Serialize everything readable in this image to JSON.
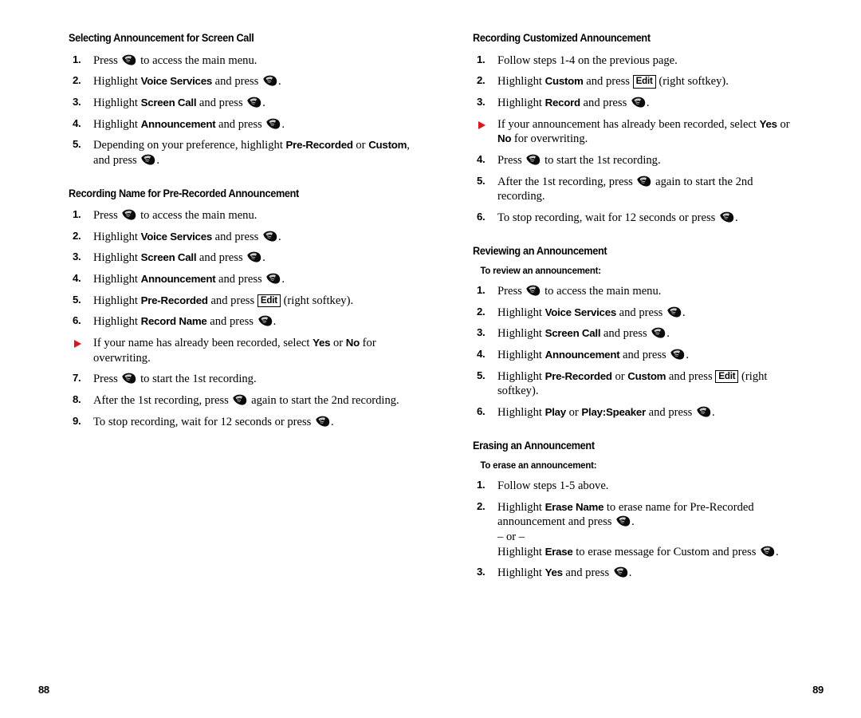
{
  "document": {
    "type": "phone-user-manual-page-spread",
    "icon_names": {
      "ok_key": "ok-key-icon",
      "note_bullet": "red-triangle-bullet-icon"
    },
    "colors": {
      "note_bullet_red": "#e1121a",
      "text": "#000000",
      "background": "#ffffff"
    }
  },
  "left_page": {
    "folio": "88",
    "sections": [
      {
        "heading": "Selecting Announcement for Screen Call",
        "steps": [
          {
            "num": "1.",
            "parts": [
              {
                "t": "text",
                "v": "Press "
              },
              {
                "t": "okkey"
              },
              {
                "t": "text",
                "v": " to access the main menu."
              }
            ]
          },
          {
            "num": "2.",
            "parts": [
              {
                "t": "text",
                "v": "Highlight "
              },
              {
                "t": "bold",
                "v": "Voice Services"
              },
              {
                "t": "text",
                "v": " and press "
              },
              {
                "t": "okkey"
              },
              {
                "t": "text",
                "v": "."
              }
            ]
          },
          {
            "num": "3.",
            "parts": [
              {
                "t": "text",
                "v": "Highlight "
              },
              {
                "t": "bold",
                "v": "Screen Call"
              },
              {
                "t": "text",
                "v": " and press "
              },
              {
                "t": "okkey"
              },
              {
                "t": "text",
                "v": "."
              }
            ]
          },
          {
            "num": "4.",
            "parts": [
              {
                "t": "text",
                "v": "Highlight "
              },
              {
                "t": "bold",
                "v": "Announcement"
              },
              {
                "t": "text",
                "v": " and press "
              },
              {
                "t": "okkey"
              },
              {
                "t": "text",
                "v": "."
              }
            ]
          },
          {
            "num": "5.",
            "parts": [
              {
                "t": "text",
                "v": "Depending on your preference, highlight "
              },
              {
                "t": "bold",
                "v": "Pre-Recorded"
              },
              {
                "t": "text",
                "v": " or "
              },
              {
                "t": "bold",
                "v": "Custom"
              },
              {
                "t": "text",
                "v": ", and press "
              },
              {
                "t": "okkey"
              },
              {
                "t": "text",
                "v": "."
              }
            ]
          }
        ]
      },
      {
        "heading": "Recording Name for Pre-Recorded Announcement",
        "steps": [
          {
            "num": "1.",
            "parts": [
              {
                "t": "text",
                "v": "Press "
              },
              {
                "t": "okkey"
              },
              {
                "t": "text",
                "v": " to access the main menu."
              }
            ]
          },
          {
            "num": "2.",
            "parts": [
              {
                "t": "text",
                "v": "Highlight "
              },
              {
                "t": "bold",
                "v": "Voice Services"
              },
              {
                "t": "text",
                "v": " and press "
              },
              {
                "t": "okkey"
              },
              {
                "t": "text",
                "v": "."
              }
            ]
          },
          {
            "num": "3.",
            "parts": [
              {
                "t": "text",
                "v": "Highlight "
              },
              {
                "t": "bold",
                "v": "Screen Call"
              },
              {
                "t": "text",
                "v": " and press "
              },
              {
                "t": "okkey"
              },
              {
                "t": "text",
                "v": "."
              }
            ]
          },
          {
            "num": "4.",
            "parts": [
              {
                "t": "text",
                "v": "Highlight "
              },
              {
                "t": "bold",
                "v": "Announcement"
              },
              {
                "t": "text",
                "v": " and press "
              },
              {
                "t": "okkey"
              },
              {
                "t": "text",
                "v": "."
              }
            ]
          },
          {
            "num": "5.",
            "parts": [
              {
                "t": "text",
                "v": "Highlight "
              },
              {
                "t": "bold",
                "v": "Pre-Recorded"
              },
              {
                "t": "text",
                "v": " and press "
              },
              {
                "t": "softkey",
                "v": "Edit"
              },
              {
                "t": "text",
                "v": " (right softkey)."
              }
            ]
          },
          {
            "num": "6.",
            "parts": [
              {
                "t": "text",
                "v": "Highlight "
              },
              {
                "t": "bold",
                "v": "Record Name"
              },
              {
                "t": "text",
                "v": " and press "
              },
              {
                "t": "okkey"
              },
              {
                "t": "text",
                "v": "."
              }
            ]
          },
          {
            "num": "note",
            "parts": [
              {
                "t": "text",
                "v": "If your name has already been recorded, select "
              },
              {
                "t": "bold",
                "v": "Yes"
              },
              {
                "t": "text",
                "v": " or "
              },
              {
                "t": "bold",
                "v": "No"
              },
              {
                "t": "text",
                "v": " for overwriting."
              }
            ]
          },
          {
            "num": "7.",
            "parts": [
              {
                "t": "text",
                "v": "Press "
              },
              {
                "t": "okkey"
              },
              {
                "t": "text",
                "v": " to start the 1st recording."
              }
            ]
          },
          {
            "num": "8.",
            "parts": [
              {
                "t": "text",
                "v": "After the 1st recording, press "
              },
              {
                "t": "okkey"
              },
              {
                "t": "text",
                "v": " again to start the 2nd recording."
              }
            ]
          },
          {
            "num": "9.",
            "parts": [
              {
                "t": "text",
                "v": "To stop recording, wait for 12 seconds or press "
              },
              {
                "t": "okkey"
              },
              {
                "t": "text",
                "v": "."
              }
            ]
          }
        ]
      }
    ]
  },
  "right_page": {
    "folio": "89",
    "sections": [
      {
        "heading": "Recording Customized Announcement",
        "steps": [
          {
            "num": "1.",
            "parts": [
              {
                "t": "text",
                "v": "Follow steps 1-4 on the previous page."
              }
            ]
          },
          {
            "num": "2.",
            "parts": [
              {
                "t": "text",
                "v": "Highlight "
              },
              {
                "t": "bold",
                "v": "Custom"
              },
              {
                "t": "text",
                "v": " and press "
              },
              {
                "t": "softkey",
                "v": "Edit"
              },
              {
                "t": "text",
                "v": " (right softkey)."
              }
            ]
          },
          {
            "num": "3.",
            "parts": [
              {
                "t": "text",
                "v": "Highlight "
              },
              {
                "t": "bold",
                "v": "Record"
              },
              {
                "t": "text",
                "v": " and press "
              },
              {
                "t": "okkey"
              },
              {
                "t": "text",
                "v": "."
              }
            ]
          },
          {
            "num": "note",
            "parts": [
              {
                "t": "text",
                "v": "If your announcement has already been recorded, select "
              },
              {
                "t": "bold",
                "v": "Yes"
              },
              {
                "t": "text",
                "v": " or "
              },
              {
                "t": "bold",
                "v": "No"
              },
              {
                "t": "text",
                "v": " for overwriting."
              }
            ]
          },
          {
            "num": "4.",
            "parts": [
              {
                "t": "text",
                "v": "Press "
              },
              {
                "t": "okkey"
              },
              {
                "t": "text",
                "v": " to start the 1st recording."
              }
            ]
          },
          {
            "num": "5.",
            "parts": [
              {
                "t": "text",
                "v": "After the 1st recording, press "
              },
              {
                "t": "okkey"
              },
              {
                "t": "text",
                "v": " again to start the 2nd recording."
              }
            ]
          },
          {
            "num": "6.",
            "parts": [
              {
                "t": "text",
                "v": "To stop recording, wait for 12 seconds or press "
              },
              {
                "t": "okkey"
              },
              {
                "t": "text",
                "v": "."
              }
            ]
          }
        ]
      },
      {
        "heading": "Reviewing an Announcement",
        "subheading": "To review an announcement:",
        "steps": [
          {
            "num": "1.",
            "parts": [
              {
                "t": "text",
                "v": "Press "
              },
              {
                "t": "okkey"
              },
              {
                "t": "text",
                "v": " to access the main menu."
              }
            ]
          },
          {
            "num": "2.",
            "parts": [
              {
                "t": "text",
                "v": "Highlight "
              },
              {
                "t": "bold",
                "v": "Voice Services"
              },
              {
                "t": "text",
                "v": " and press "
              },
              {
                "t": "okkey"
              },
              {
                "t": "text",
                "v": "."
              }
            ]
          },
          {
            "num": "3.",
            "parts": [
              {
                "t": "text",
                "v": "Highlight "
              },
              {
                "t": "bold",
                "v": "Screen Call"
              },
              {
                "t": "text",
                "v": " and press "
              },
              {
                "t": "okkey"
              },
              {
                "t": "text",
                "v": "."
              }
            ]
          },
          {
            "num": "4.",
            "parts": [
              {
                "t": "text",
                "v": "Highlight "
              },
              {
                "t": "bold",
                "v": "Announcement"
              },
              {
                "t": "text",
                "v": " and press "
              },
              {
                "t": "okkey"
              },
              {
                "t": "text",
                "v": "."
              }
            ]
          },
          {
            "num": "5.",
            "parts": [
              {
                "t": "text",
                "v": "Highlight "
              },
              {
                "t": "bold",
                "v": "Pre-Recorded"
              },
              {
                "t": "text",
                "v": " or "
              },
              {
                "t": "bold",
                "v": "Custom"
              },
              {
                "t": "text",
                "v": " and press "
              },
              {
                "t": "softkey",
                "v": "Edit"
              },
              {
                "t": "text",
                "v": " (right softkey)."
              }
            ]
          },
          {
            "num": "6.",
            "parts": [
              {
                "t": "text",
                "v": "Highlight "
              },
              {
                "t": "bold",
                "v": "Play"
              },
              {
                "t": "text",
                "v": " or "
              },
              {
                "t": "bold",
                "v": "Play:Speaker"
              },
              {
                "t": "text",
                "v": " and press "
              },
              {
                "t": "okkey"
              },
              {
                "t": "text",
                "v": "."
              }
            ]
          }
        ]
      },
      {
        "heading": "Erasing an Announcement",
        "subheading": "To erase an announcement:",
        "steps": [
          {
            "num": "1.",
            "parts": [
              {
                "t": "text",
                "v": "Follow steps 1-5 above."
              }
            ]
          },
          {
            "num": "2.",
            "parts": [
              {
                "t": "text",
                "v": "Highlight "
              },
              {
                "t": "bold",
                "v": "Erase Name"
              },
              {
                "t": "text",
                "v": " to erase name for Pre-Recorded announcement and press "
              },
              {
                "t": "okkey"
              },
              {
                "t": "text",
                "v": "."
              },
              {
                "t": "break"
              },
              {
                "t": "text",
                "v": "– or –"
              },
              {
                "t": "break"
              },
              {
                "t": "text",
                "v": "Highlight "
              },
              {
                "t": "bold",
                "v": "Erase"
              },
              {
                "t": "text",
                "v": " to erase message for Custom and press "
              },
              {
                "t": "okkey"
              },
              {
                "t": "text",
                "v": "."
              }
            ]
          },
          {
            "num": "3.",
            "parts": [
              {
                "t": "text",
                "v": "Highlight "
              },
              {
                "t": "bold",
                "v": "Yes"
              },
              {
                "t": "text",
                "v": " and press "
              },
              {
                "t": "okkey"
              },
              {
                "t": "text",
                "v": "."
              }
            ]
          }
        ]
      }
    ]
  }
}
